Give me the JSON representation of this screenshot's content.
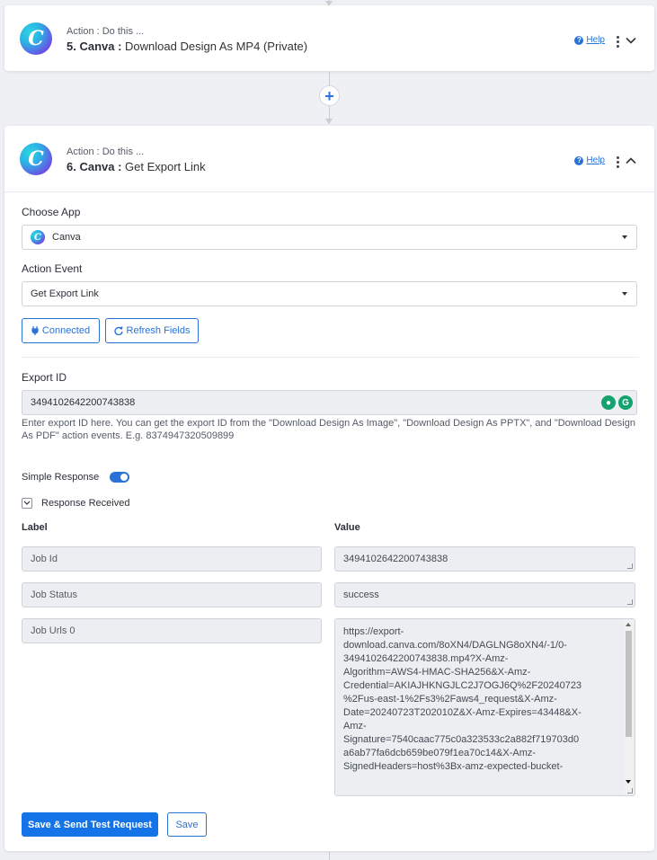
{
  "step5": {
    "action_sub": "Action : Do this ...",
    "number_app": "5. Canva : ",
    "event": "Download Design As MP4 (Private)",
    "help_label": "Help",
    "logo_letter": "C"
  },
  "step6": {
    "action_sub": "Action : Do this ...",
    "number_app": "6. Canva : ",
    "event": "Get Export Link",
    "help_label": "Help",
    "logo_letter": "C",
    "choose_app_label": "Choose App",
    "choose_app_value": "Canva",
    "action_event_label": "Action Event",
    "action_event_value": "Get Export Link",
    "connected_label": "Connected",
    "refresh_label": "Refresh Fields",
    "export_id_label": "Export ID",
    "export_id_value": "3494102642200743838",
    "export_id_hint": "Enter export ID here. You can get the export ID from the \"Download Design As Image\", \"Download Design As PPTX\", and \"Download Design As PDF\" action events. E.g. 8374947320509899",
    "simple_response_label": "Simple Response",
    "simple_response_on": true,
    "response_received_label": "Response Received",
    "col_label": "Label",
    "col_value": "Value",
    "rows": [
      {
        "label": "Job Id",
        "value": "3494102642200743838"
      },
      {
        "label": "Job Status",
        "value": "success"
      },
      {
        "label": "Job Urls 0",
        "value": "https://export-\ndownload.canva.com/8oXN4/DAGLNG8oXN4/-1/0-\n3494102642200743838.mp4?X-Amz-\nAlgorithm=AWS4-HMAC-SHA256&X-Amz-\nCredential=AKIAJHKNGJLC2J7OGJ6Q%2F20240723\n%2Fus-east-1%2Fs3%2Faws4_request&X-Amz-\nDate=20240723T202010Z&X-Amz-Expires=43448&X-\nAmz-\nSignature=7540caac775c0a323533c2a882f719703d0\na6ab77fa6dcb659be079f1ea70c14&X-Amz-\nSignedHeaders=host%3Bx-amz-expected-bucket-"
      }
    ],
    "save_send_label": "Save & Send Test Request",
    "save_label": "Save"
  },
  "colors": {
    "accent": "#1473e6",
    "link": "#2b72d6",
    "canvas_bg": "#eef0f4"
  },
  "icons": [
    "help-icon",
    "kebab-menu-icon",
    "chevron-down-icon",
    "chevron-up-icon",
    "plus-icon",
    "plug-icon",
    "refresh-icon",
    "grammarly-icon",
    "lightbulb-icon",
    "dropdown-caret-icon"
  ]
}
